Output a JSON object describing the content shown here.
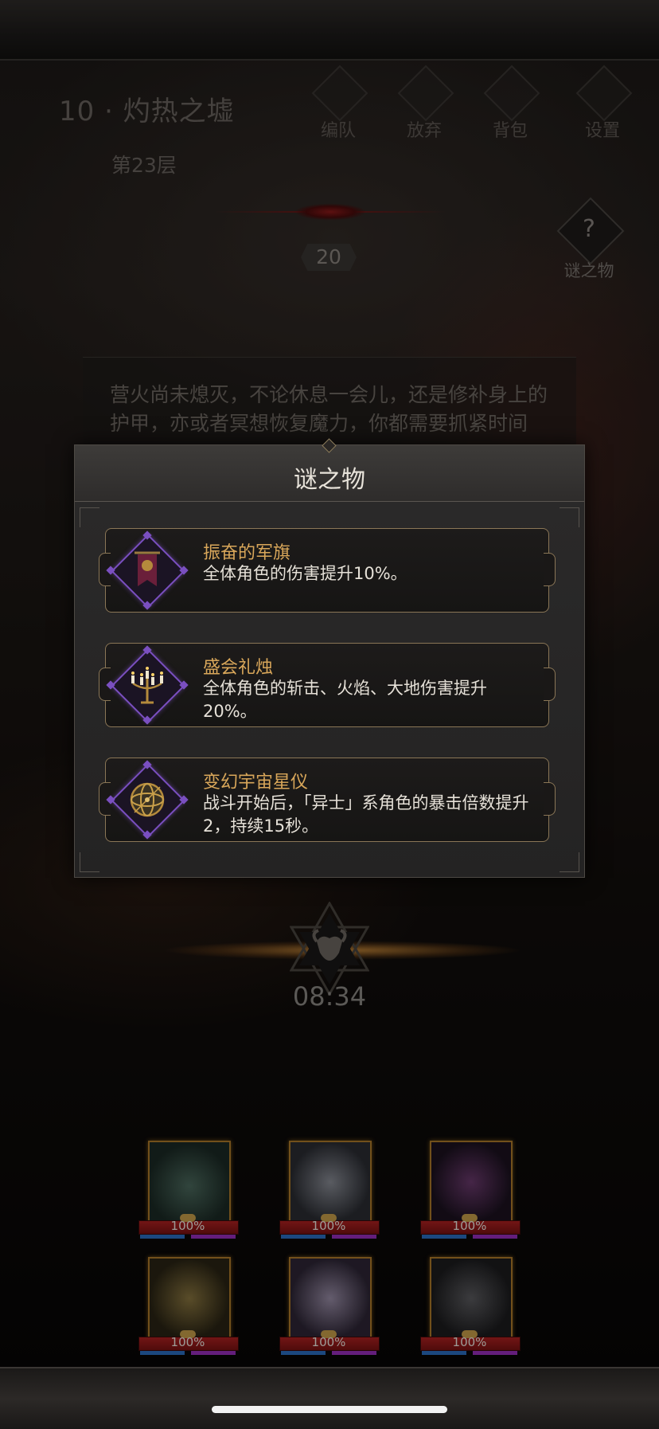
{
  "header": {
    "stage_title": "10 · 灼热之墟",
    "floor": "第23层",
    "buttons": [
      "编队",
      "放弃",
      "背包",
      "设置"
    ],
    "counter": "20",
    "mystery_button": "谜之物"
  },
  "story": {
    "text": "营火尚未熄灭，不论休息一会儿，还是修补身上的护甲，亦或者冥想恢复魔力，你都需要抓紧时间"
  },
  "modal": {
    "title": "谜之物",
    "items": [
      {
        "name": "振奋的军旗",
        "desc": "全体角色的伤害提升10%。",
        "icon": "war-banner-icon"
      },
      {
        "name": "盛会礼烛",
        "desc": "全体角色的斩击、火焰、大地伤害提升20%。",
        "icon": "candelabra-icon"
      },
      {
        "name": "变幻宇宙星仪",
        "desc": "战斗开始后，「异士」系角色的暴击倍数提升2，持续15秒。",
        "icon": "armillary-sphere-icon"
      }
    ]
  },
  "timer": {
    "value": "08:34",
    "icon": "goat-hexagram-icon"
  },
  "party": {
    "heroes": [
      {
        "hp_label": "100%",
        "hp_fraction": 1.0,
        "portrait": "antlered-elf"
      },
      {
        "hp_label": "100%",
        "hp_fraction": 1.0,
        "portrait": "pale-youth"
      },
      {
        "hp_label": "100%",
        "hp_fraction": 1.0,
        "portrait": "dark-masked-figure"
      },
      {
        "hp_label": "100%",
        "hp_fraction": 1.0,
        "portrait": "blonde-warrior"
      },
      {
        "hp_label": "100%",
        "hp_fraction": 1.0,
        "portrait": "silver-haired-woman"
      },
      {
        "hp_label": "100%",
        "hp_fraction": 1.0,
        "portrait": "armored-dragon"
      }
    ]
  },
  "colors": {
    "item_name": "#d9a75a",
    "icon_frame": "#7a4fc0",
    "hp_bar": "#b02121",
    "portrait_border": "#b07c2a"
  }
}
